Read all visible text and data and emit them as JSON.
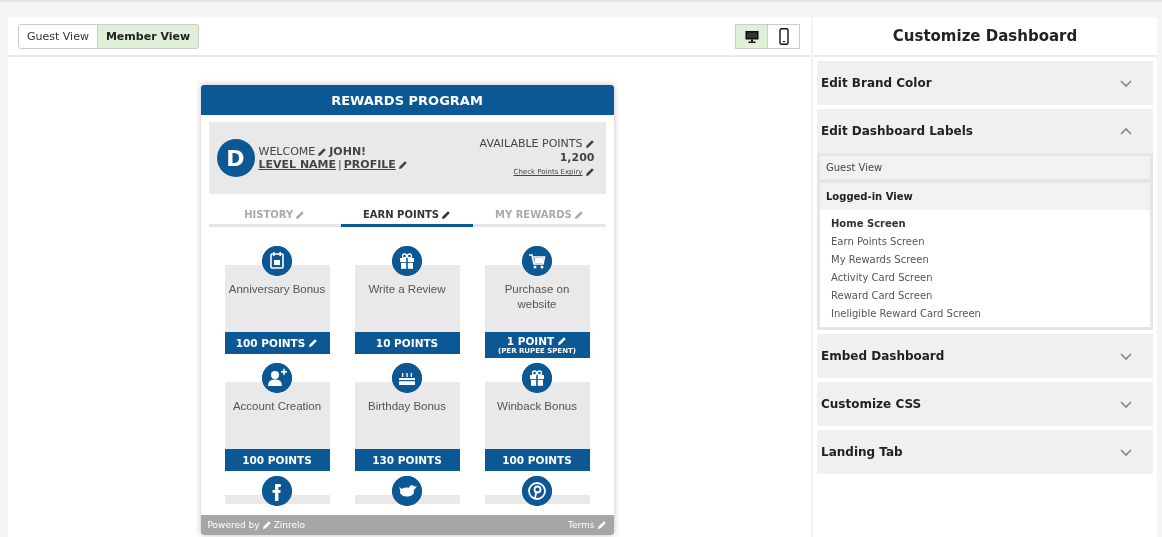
{
  "view_toggle": [
    {
      "label": "Guest View",
      "selected": false
    },
    {
      "label": "Member View",
      "selected": true
    }
  ],
  "device_toggle": [
    {
      "kind": "desktop",
      "selected": true
    },
    {
      "kind": "mobile",
      "selected": false
    }
  ],
  "widget": {
    "title": "REWARDS PROGRAM",
    "avatar_letter": "D",
    "welcome": "WELCOME",
    "name": "JOHN!",
    "level": "LEVEL NAME",
    "separator": "|",
    "profile": "PROFILE",
    "points_label": "AVAILABLE POINTS",
    "points": "1,200",
    "expiry_link": "Check Points Expiry",
    "tabs": [
      {
        "label": "HISTORY",
        "selected": false
      },
      {
        "label": "EARN POINTS",
        "selected": true
      },
      {
        "label": "MY REWARDS",
        "selected": false
      }
    ],
    "cards": [
      {
        "kind": "calendar",
        "title": "Anniversary Bonus",
        "points": "100 POINTS",
        "editable": true
      },
      {
        "kind": "gift",
        "title": "Write a Review",
        "points": "10 POINTS",
        "editable": false
      },
      {
        "kind": "cart",
        "title": "Purchase on website",
        "points": "1 POINT",
        "note": "(PER RUPEE SPENT)",
        "editable": true
      },
      {
        "kind": "user-plus",
        "title": "Account Creation",
        "points": "100 POINTS",
        "editable": false
      },
      {
        "kind": "cake",
        "title": "Birthday Bonus",
        "points": "130 POINTS",
        "editable": false
      },
      {
        "kind": "gift",
        "title": "Winback Bonus",
        "points": "100 POINTS",
        "editable": false
      },
      {
        "kind": "facebook"
      },
      {
        "kind": "twitter"
      },
      {
        "kind": "pinterest"
      }
    ],
    "footer": {
      "powered": "Powered by",
      "brand": "Zinrelo",
      "terms": "Terms"
    }
  },
  "panel": {
    "title": "Customize Dashboard",
    "sections": [
      {
        "title": "Edit Brand Color",
        "expanded": false
      },
      {
        "title": "Edit Dashboard Labels",
        "expanded": true,
        "subsections": [
          {
            "title": "Guest View",
            "expanded": false
          },
          {
            "title": "Logged-in View",
            "expanded": true,
            "items": [
              {
                "label": "Home Screen",
                "selected": true
              },
              {
                "label": "Earn Points Screen",
                "selected": false
              },
              {
                "label": "My Rewards Screen",
                "selected": false
              },
              {
                "label": "Activity Card Screen",
                "selected": false
              },
              {
                "label": "Reward Card Screen",
                "selected": false
              },
              {
                "label": "Ineligible Reward Card Screen",
                "selected": false
              }
            ]
          }
        ]
      },
      {
        "title": "Embed Dashboard",
        "expanded": false
      },
      {
        "title": "Customize CSS",
        "expanded": false
      },
      {
        "title": "Landing Tab",
        "expanded": false
      }
    ]
  }
}
